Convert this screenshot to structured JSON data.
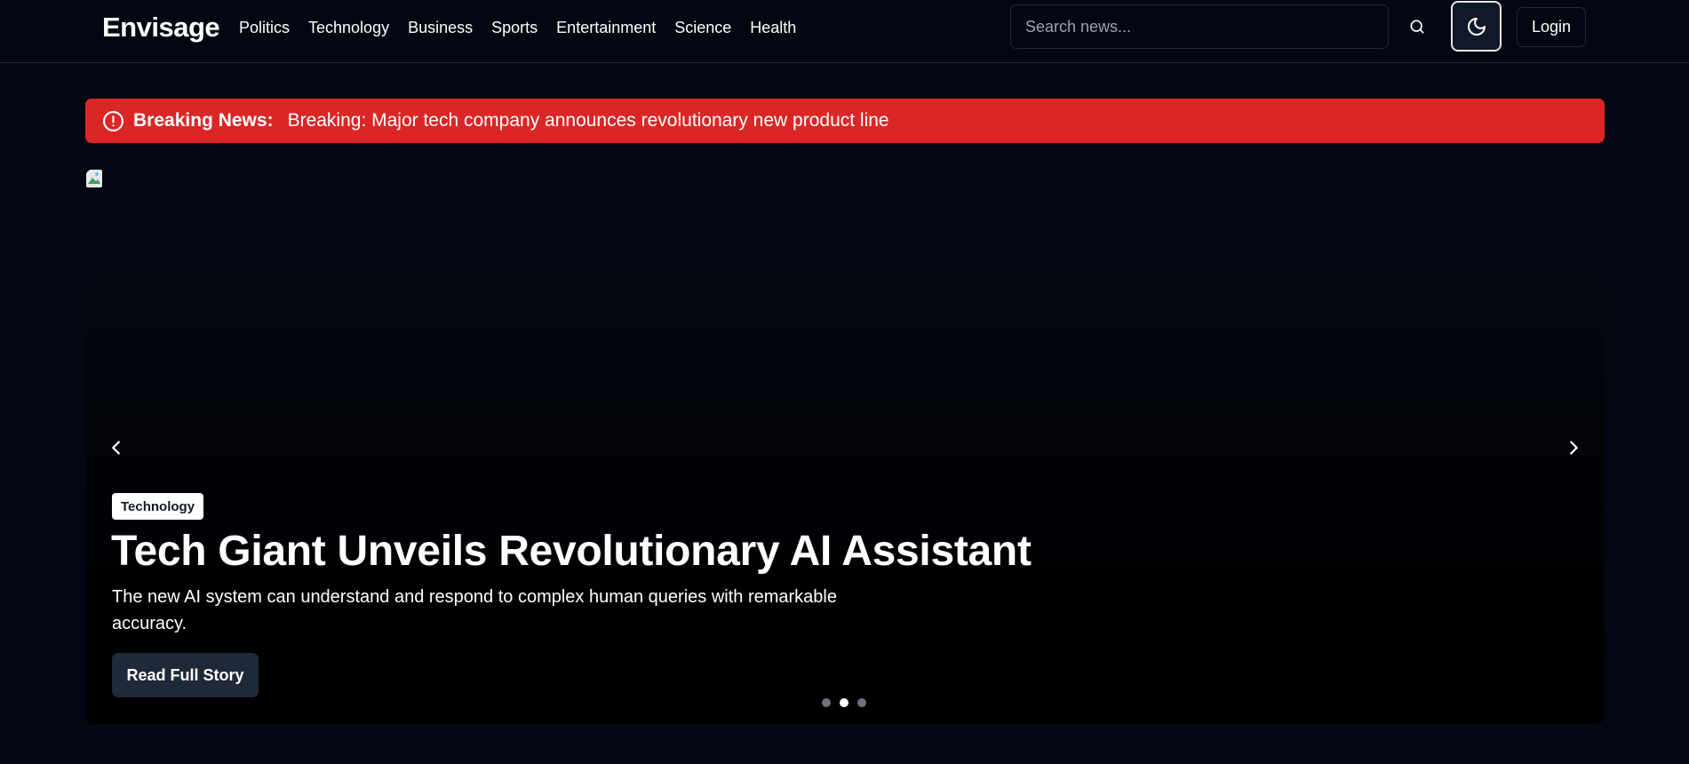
{
  "header": {
    "brand": "Envisage",
    "nav": [
      "Politics",
      "Technology",
      "Business",
      "Sports",
      "Entertainment",
      "Science",
      "Health"
    ],
    "search_placeholder": "Search news...",
    "search_icon": "search-icon",
    "theme_icon": "moon-icon",
    "login_label": "Login"
  },
  "breaking": {
    "label": "Breaking News:",
    "text": "Breaking: Major tech company announces revolutionary new product line",
    "icon": "alert-circle-icon",
    "color": "#dc2626"
  },
  "hero": {
    "category": "Technology",
    "title": "Tech Giant Unveils Revolutionary AI Assistant",
    "description": "The new AI system can understand and respond to complex human queries with remarkable accuracy.",
    "cta_label": "Read Full Story",
    "slide_count": 3,
    "active_slide": 2
  },
  "colors": {
    "background": "#030712",
    "button_bg": "#1f2937",
    "accent": "#dc2626"
  }
}
